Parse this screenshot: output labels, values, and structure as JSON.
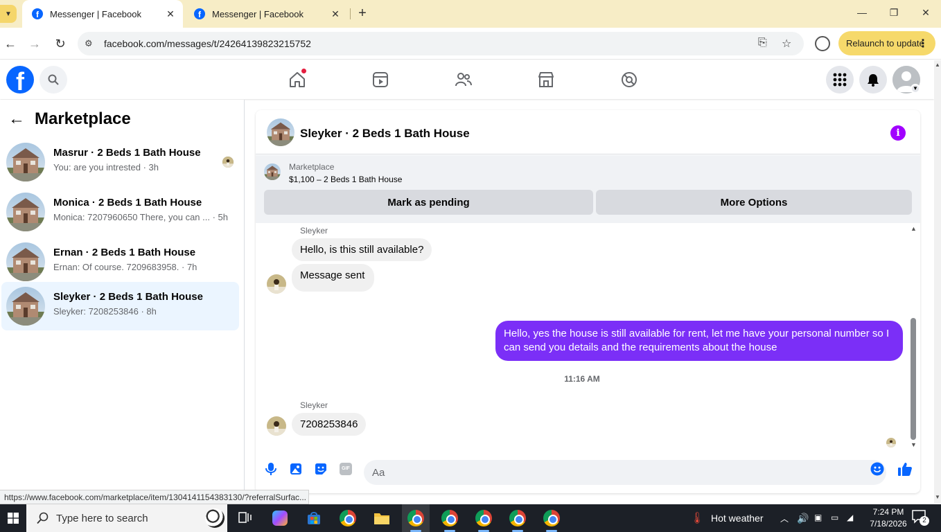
{
  "browser": {
    "tabs": [
      {
        "title": "Messenger | Facebook",
        "active": true
      },
      {
        "title": "Messenger | Facebook",
        "active": false
      }
    ],
    "new_tab": "+",
    "url": "facebook.com/messages/t/24264139823215752",
    "relaunch_label": "Relaunch to update",
    "status_url": "https://www.facebook.com/marketplace/item/1304141154383130/?referralSurfac..."
  },
  "sidebar": {
    "title": "Marketplace",
    "conversations": [
      {
        "name": "Masrur · 2 Beds 1 Bath House",
        "preview": "You: are you intrested · 3h",
        "active": false,
        "seen": true
      },
      {
        "name": "Monica · 2 Beds 1 Bath House",
        "preview": "Monica: 7207960650 There, you can ... · 5h",
        "active": false,
        "seen": false
      },
      {
        "name": "Ernan · 2 Beds 1 Bath House",
        "preview": "Ernan: Of course. 7209683958. · 7h",
        "active": false,
        "seen": false
      },
      {
        "name": "Sleyker · 2 Beds 1 Bath House",
        "preview": "Sleyker: 7208253846 · 8h",
        "active": true,
        "seen": false
      }
    ]
  },
  "chat": {
    "title": "Sleyker · 2 Beds 1 Bath House",
    "listing": {
      "category": "Marketplace",
      "price_line": "$1,100 – 2 Beds 1 Bath House",
      "mark_pending_label": "Mark as pending",
      "more_options_label": "More Options"
    },
    "messages": {
      "sender_1": "Sleyker",
      "in_1": "Hello, is this still available?",
      "in_2": "Message sent",
      "out_1": "Hello, yes the house is still available for rent, let me have your personal number so I can send you details and the requirements about the house",
      "timestamp": "11:16 AM",
      "sender_2": "Sleyker",
      "in_3": "7208253846"
    },
    "composer_placeholder": "Aa",
    "gif_label": "GIF"
  },
  "taskbar": {
    "search_placeholder": "Type here to search",
    "weather": "Hot weather",
    "time": "7:24 PM",
    "date": "7/18/2026",
    "notifications": "2"
  },
  "colors": {
    "facebook_blue": "#0866ff",
    "outgoing_bubble": "#7b2ff7",
    "info_icon": "#a100ff",
    "tab_strip": "#f7edc6",
    "relaunch": "#f6d96b"
  }
}
